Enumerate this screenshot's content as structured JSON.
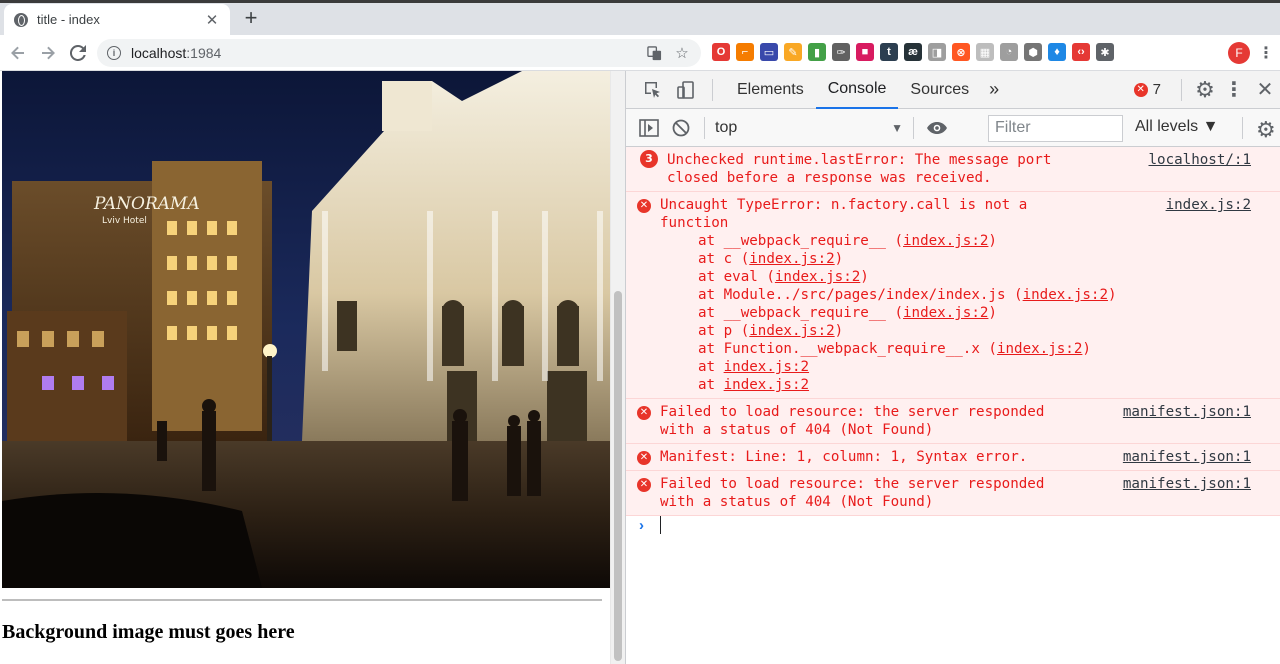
{
  "browser": {
    "tab_title": "title - index",
    "tab_close": "✕",
    "new_tab": "+",
    "url_host": "localhost",
    "url_port": ":1984",
    "back_icon": "arrow-left-icon",
    "forward_icon": "arrow-right-icon",
    "reload_icon": "reload-icon",
    "profile_initial": "F",
    "extensions": [
      {
        "name": "opera-ext-icon",
        "glyph": "O",
        "color": "#e53935"
      },
      {
        "name": "brush-ext-icon",
        "glyph": "⌐",
        "color": "#f57c00"
      },
      {
        "name": "window-ext-icon",
        "glyph": "▭",
        "color": "#3949ab"
      },
      {
        "name": "pencil-ext-icon",
        "glyph": "✎",
        "color": "#f9a825"
      },
      {
        "name": "chart-ext-icon",
        "glyph": "▮",
        "color": "#43a047"
      },
      {
        "name": "dropper-ext-icon",
        "glyph": "✑",
        "color": "#616161"
      },
      {
        "name": "gradient-ext-icon",
        "glyph": "■",
        "color": "#d81b60"
      },
      {
        "name": "tumblr-ext-icon",
        "glyph": "t",
        "color": "#2c3e50"
      },
      {
        "name": "ae-ext-icon",
        "glyph": "æ",
        "color": "#263238"
      },
      {
        "name": "screenshot-ext-icon",
        "glyph": "◨",
        "color": "#9e9e9e"
      },
      {
        "name": "blocker-ext-icon",
        "glyph": "⊗",
        "color": "#ff5722"
      },
      {
        "name": "grid-ext-icon",
        "glyph": "▦",
        "color": "#bdbdbd"
      },
      {
        "name": "timer-ext-icon",
        "glyph": "◔",
        "color": "#9e9e9e"
      },
      {
        "name": "cube-ext-icon",
        "glyph": "⬢",
        "color": "#757575"
      },
      {
        "name": "drop-ext-icon",
        "glyph": "♦",
        "color": "#1e88e5"
      },
      {
        "name": "code-ext-icon",
        "glyph": "‹›",
        "color": "#e53935"
      },
      {
        "name": "puzzle-ext-icon",
        "glyph": "✱",
        "color": "#5f6368"
      }
    ]
  },
  "page": {
    "heading": "Background image must goes here"
  },
  "devtools": {
    "tabs": [
      "Elements",
      "Console",
      "Sources"
    ],
    "active_tab": "Console",
    "more_tabs": "»",
    "error_count": "7",
    "context": "top",
    "filter_placeholder": "Filter",
    "levels": "All levels ▼",
    "messages": [
      {
        "badge": "3",
        "text": "Unchecked runtime.lastError: The message port\nclosed before a response was received.",
        "source": "localhost/:1"
      },
      {
        "text": "Uncaught TypeError: n.factory.call is not a\nfunction",
        "source": "index.js:2",
        "stack": [
          {
            "pre": "at __webpack_require__ (",
            "link": "index.js:2",
            "post": ")"
          },
          {
            "pre": "at c (",
            "link": "index.js:2",
            "post": ")"
          },
          {
            "pre": "at eval (",
            "link": "index.js:2",
            "post": ")"
          },
          {
            "pre": "at Module../src/pages/index/index.js (",
            "link": "index.js:2",
            "post": ")"
          },
          {
            "pre": "at __webpack_require__ (",
            "link": "index.js:2",
            "post": ")"
          },
          {
            "pre": "at p (",
            "link": "index.js:2",
            "post": ")"
          },
          {
            "pre": "at Function.__webpack_require__.x (",
            "link": "index.js:2",
            "post": ")"
          },
          {
            "pre": "at ",
            "link": "index.js:2",
            "post": ""
          },
          {
            "pre": "at ",
            "link": "index.js:2",
            "post": ""
          }
        ]
      },
      {
        "text": "Failed to load resource: the server responded\nwith a status of 404 (Not Found)",
        "source": "manifest.json:1"
      },
      {
        "text": "Manifest: Line: 1, column: 1, Syntax error.",
        "source": "manifest.json:1"
      },
      {
        "text": "Failed to load resource: the server responded\nwith a status of 404 (Not Found)",
        "source": "manifest.json:1"
      }
    ],
    "prompt": "›"
  }
}
